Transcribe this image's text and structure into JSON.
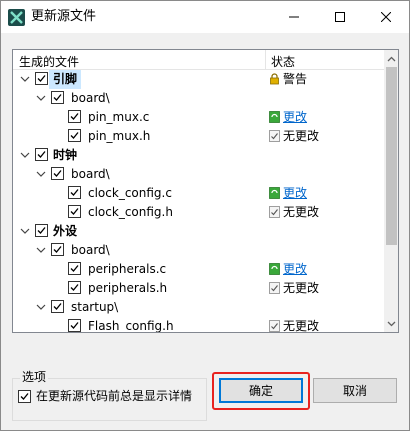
{
  "window": {
    "title": "更新源文件"
  },
  "tree": {
    "columns": {
      "file": "生成的文件",
      "status": "状态"
    },
    "rows": [
      {
        "label": "引脚",
        "status": "警告"
      },
      {
        "label": "board\\",
        "status": ""
      },
      {
        "label": "pin_mux.c",
        "status": "更改"
      },
      {
        "label": "pin_mux.h",
        "status": "无更改"
      },
      {
        "label": "时钟",
        "status": ""
      },
      {
        "label": "board\\",
        "status": ""
      },
      {
        "label": "clock_config.c",
        "status": "更改"
      },
      {
        "label": "clock_config.h",
        "status": "无更改"
      },
      {
        "label": "外设",
        "status": ""
      },
      {
        "label": "board\\",
        "status": ""
      },
      {
        "label": "peripherals.c",
        "status": "更改"
      },
      {
        "label": "peripherals.h",
        "status": "无更改"
      },
      {
        "label": "startup\\",
        "status": ""
      },
      {
        "label": "Flash_config.h",
        "status": "无更改"
      }
    ]
  },
  "options": {
    "group_title": "选项",
    "show_details_label": "在更新源代码前总是显示详情",
    "show_details_checked": true
  },
  "buttons": {
    "ok": "确定",
    "cancel": "取消"
  },
  "colors": {
    "link": "#0066cc",
    "selection": "#cce8ff",
    "highlight_box": "#e8231f",
    "default_button_border": "#0078d7"
  }
}
